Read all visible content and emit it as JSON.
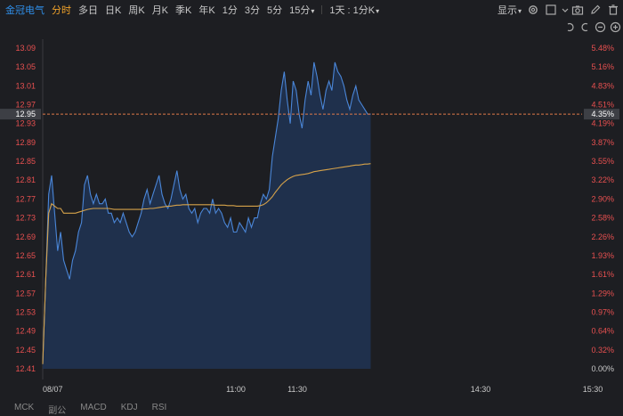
{
  "toolbar": {
    "stock_name": "金冠电气",
    "tabs": [
      "分时",
      "多日",
      "日K",
      "周K",
      "月K",
      "季K",
      "年K",
      "1分",
      "3分",
      "5分",
      "15分"
    ],
    "active_tab": "分时",
    "range_select": "1天 : 1分K",
    "display_label": "显示"
  },
  "icons": [
    "settings-icon",
    "checkbox-icon",
    "camera-icon",
    "pencil-icon",
    "trash-icon",
    "undo-icon",
    "redo-icon",
    "zoom-out-icon",
    "zoom-in-icon"
  ],
  "colors": {
    "background": "#1d1e22",
    "price_line": "#4a86d8",
    "avg_line": "#d6a24a",
    "axis_text_left": "#e85050",
    "reference_line": "#e07a4a",
    "highlight": "#3d3f45"
  },
  "chart_data": {
    "type": "line",
    "title": "",
    "x_ticks": [
      "08/07",
      "11:00",
      "11:30",
      "14:30",
      "15:30"
    ],
    "y_left_ticks": [
      "13.09",
      "13.05",
      "13.01",
      "12.97",
      "12.93",
      "12.89",
      "12.85",
      "12.81",
      "12.77",
      "12.73",
      "12.69",
      "12.65",
      "12.61",
      "12.57",
      "12.53",
      "12.49",
      "12.45",
      "12.41"
    ],
    "y_right_ticks": [
      "5.48%",
      "5.16%",
      "4.83%",
      "4.51%",
      "4.19%",
      "3.87%",
      "3.55%",
      "3.22%",
      "2.90%",
      "2.58%",
      "2.26%",
      "1.93%",
      "1.61%",
      "1.29%",
      "0.97%",
      "0.64%",
      "0.32%",
      "0.00%"
    ],
    "ylim": [
      12.41,
      13.09
    ],
    "current_price": "12.95",
    "current_pct": "4.35%",
    "x_count": 121,
    "series": [
      {
        "name": "price",
        "values": [
          12.42,
          12.6,
          12.78,
          12.82,
          12.74,
          12.66,
          12.7,
          12.64,
          12.62,
          12.6,
          12.64,
          12.66,
          12.7,
          12.72,
          12.8,
          12.82,
          12.78,
          12.76,
          12.78,
          12.76,
          12.76,
          12.77,
          12.74,
          12.74,
          12.72,
          12.73,
          12.72,
          12.74,
          12.72,
          12.7,
          12.69,
          12.7,
          12.72,
          12.74,
          12.77,
          12.79,
          12.76,
          12.78,
          12.8,
          12.82,
          12.78,
          12.76,
          12.75,
          12.77,
          12.8,
          12.83,
          12.79,
          12.77,
          12.78,
          12.75,
          12.74,
          12.75,
          12.72,
          12.74,
          12.75,
          12.75,
          12.74,
          12.77,
          12.74,
          12.75,
          12.74,
          12.72,
          12.71,
          12.73,
          12.7,
          12.7,
          12.72,
          12.71,
          12.7,
          12.73,
          12.71,
          12.73,
          12.73,
          12.76,
          12.78,
          12.77,
          12.79,
          12.86,
          12.9,
          12.94,
          13.0,
          13.04,
          12.98,
          12.93,
          13.02,
          13.0,
          12.95,
          12.92,
          12.98,
          13.02,
          12.99,
          13.06,
          13.03,
          12.99,
          12.96,
          13.0,
          13.02,
          13.0,
          13.06,
          13.04,
          13.03,
          13.01,
          12.98,
          12.96,
          12.99,
          13.01,
          12.98,
          12.97,
          12.96,
          12.95,
          12.95
        ],
        "mapped_x": "index"
      },
      {
        "name": "average",
        "values": [
          12.42,
          12.6,
          12.74,
          12.76,
          12.755,
          12.75,
          12.75,
          12.74,
          12.74,
          12.74,
          12.74,
          12.74,
          12.742,
          12.744,
          12.746,
          12.748,
          12.749,
          12.75,
          12.75,
          12.75,
          12.75,
          12.75,
          12.75,
          12.749,
          12.748,
          12.748,
          12.748,
          12.748,
          12.748,
          12.748,
          12.748,
          12.748,
          12.748,
          12.748,
          12.749,
          12.749,
          12.75,
          12.75,
          12.751,
          12.752,
          12.753,
          12.754,
          12.755,
          12.755,
          12.756,
          12.757,
          12.757,
          12.758,
          12.758,
          12.758,
          12.758,
          12.758,
          12.758,
          12.758,
          12.758,
          12.758,
          12.758,
          12.758,
          12.757,
          12.757,
          12.757,
          12.757,
          12.756,
          12.756,
          12.756,
          12.755,
          12.755,
          12.755,
          12.755,
          12.755,
          12.755,
          12.755,
          12.755,
          12.756,
          12.758,
          12.762,
          12.768,
          12.775,
          12.784,
          12.792,
          12.8,
          12.806,
          12.811,
          12.815,
          12.818,
          12.82,
          12.821,
          12.822,
          12.823,
          12.824,
          12.826,
          12.828,
          12.829,
          12.83,
          12.831,
          12.832,
          12.833,
          12.834,
          12.835,
          12.836,
          12.837,
          12.838,
          12.839,
          12.84,
          12.841,
          12.842,
          12.842,
          12.843,
          12.844,
          12.844,
          12.845
        ]
      }
    ],
    "grid": false
  },
  "bottom_tabs": [
    "MCK",
    "副公",
    "MACD",
    "KDJ",
    "RSI"
  ]
}
